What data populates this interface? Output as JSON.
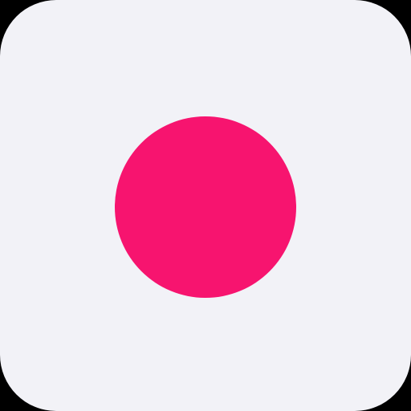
{
  "app_icon": {
    "icon": "record-dot-icon",
    "background_color": "#f2f2f7",
    "dot_color": "#f7146f",
    "outer_background_color": "#000000"
  }
}
